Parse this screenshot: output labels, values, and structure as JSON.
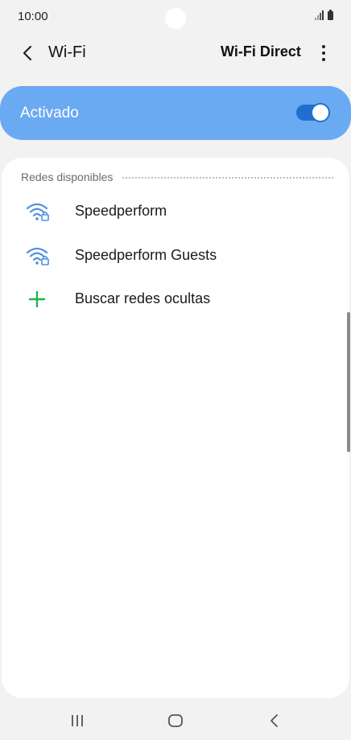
{
  "status_bar": {
    "time": "10:00"
  },
  "header": {
    "back_icon": "chevron-left-icon",
    "title": "Wi-Fi",
    "wifi_direct_label": "Wi-Fi Direct",
    "more_icon": "more-vertical-icon"
  },
  "toggle": {
    "label": "Activado",
    "state": "on",
    "colors": {
      "card": "#6aaaf2",
      "switch": "#1f6fd1"
    }
  },
  "networks": {
    "section_title": "Redes disponibles",
    "items": [
      {
        "label": "Speedperform",
        "icon": "wifi-locked-icon"
      },
      {
        "label": "Speedperform Guests",
        "icon": "wifi-locked-icon"
      },
      {
        "label": "Buscar redes ocultas",
        "icon": "plus-icon"
      }
    ]
  },
  "nav_bar": {
    "recents_icon": "recents-icon",
    "home_icon": "home-icon",
    "back_icon": "back-icon"
  },
  "colors": {
    "accent": "#1f6fd1",
    "plus": "#23b14d",
    "wifi_icon": "#4f90e0"
  }
}
